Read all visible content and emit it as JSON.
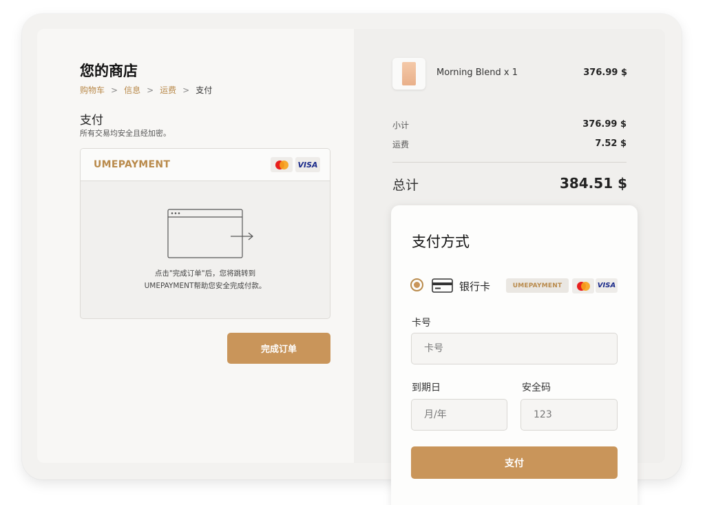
{
  "store": {
    "title": "您的商店"
  },
  "breadcrumb": {
    "items": [
      {
        "label": "购物车"
      },
      {
        "label": "信息"
      },
      {
        "label": "运费"
      },
      {
        "label": "支付"
      }
    ],
    "separator": ">"
  },
  "payment_section": {
    "title": "支付",
    "subtitle": "所有交易均安全且经加密。",
    "provider": "UMEPAYMENT",
    "card_brands": [
      "mastercard-icon",
      "VISA"
    ],
    "redirect_text_line1": "点击\"完成订单\"后，您将跳转到",
    "redirect_text_line2": "UMEPAYMENT帮助您安全完成付款。",
    "complete_button": "完成订单"
  },
  "order": {
    "product_name": "Morning Blend x 1",
    "product_price": "376.99 $",
    "subtotal_label": "小计",
    "subtotal_value": "376.99 $",
    "shipping_label": "运费",
    "shipping_value": "7.52 $",
    "total_label": "总计",
    "total_value": "384.51 $"
  },
  "payment_method": {
    "title": "支付方式",
    "option_label": "银行卡",
    "badge": "UMEPAYMENT",
    "visa": "VISA",
    "card_number_label": "卡号",
    "card_number_placeholder": "卡号",
    "expiry_label": "到期日",
    "expiry_placeholder": "月/年",
    "cvv_label": "安全码",
    "cvv_placeholder": "123",
    "pay_button": "支付"
  },
  "colors": {
    "accent": "#c9955a",
    "link": "#b98a4b"
  }
}
